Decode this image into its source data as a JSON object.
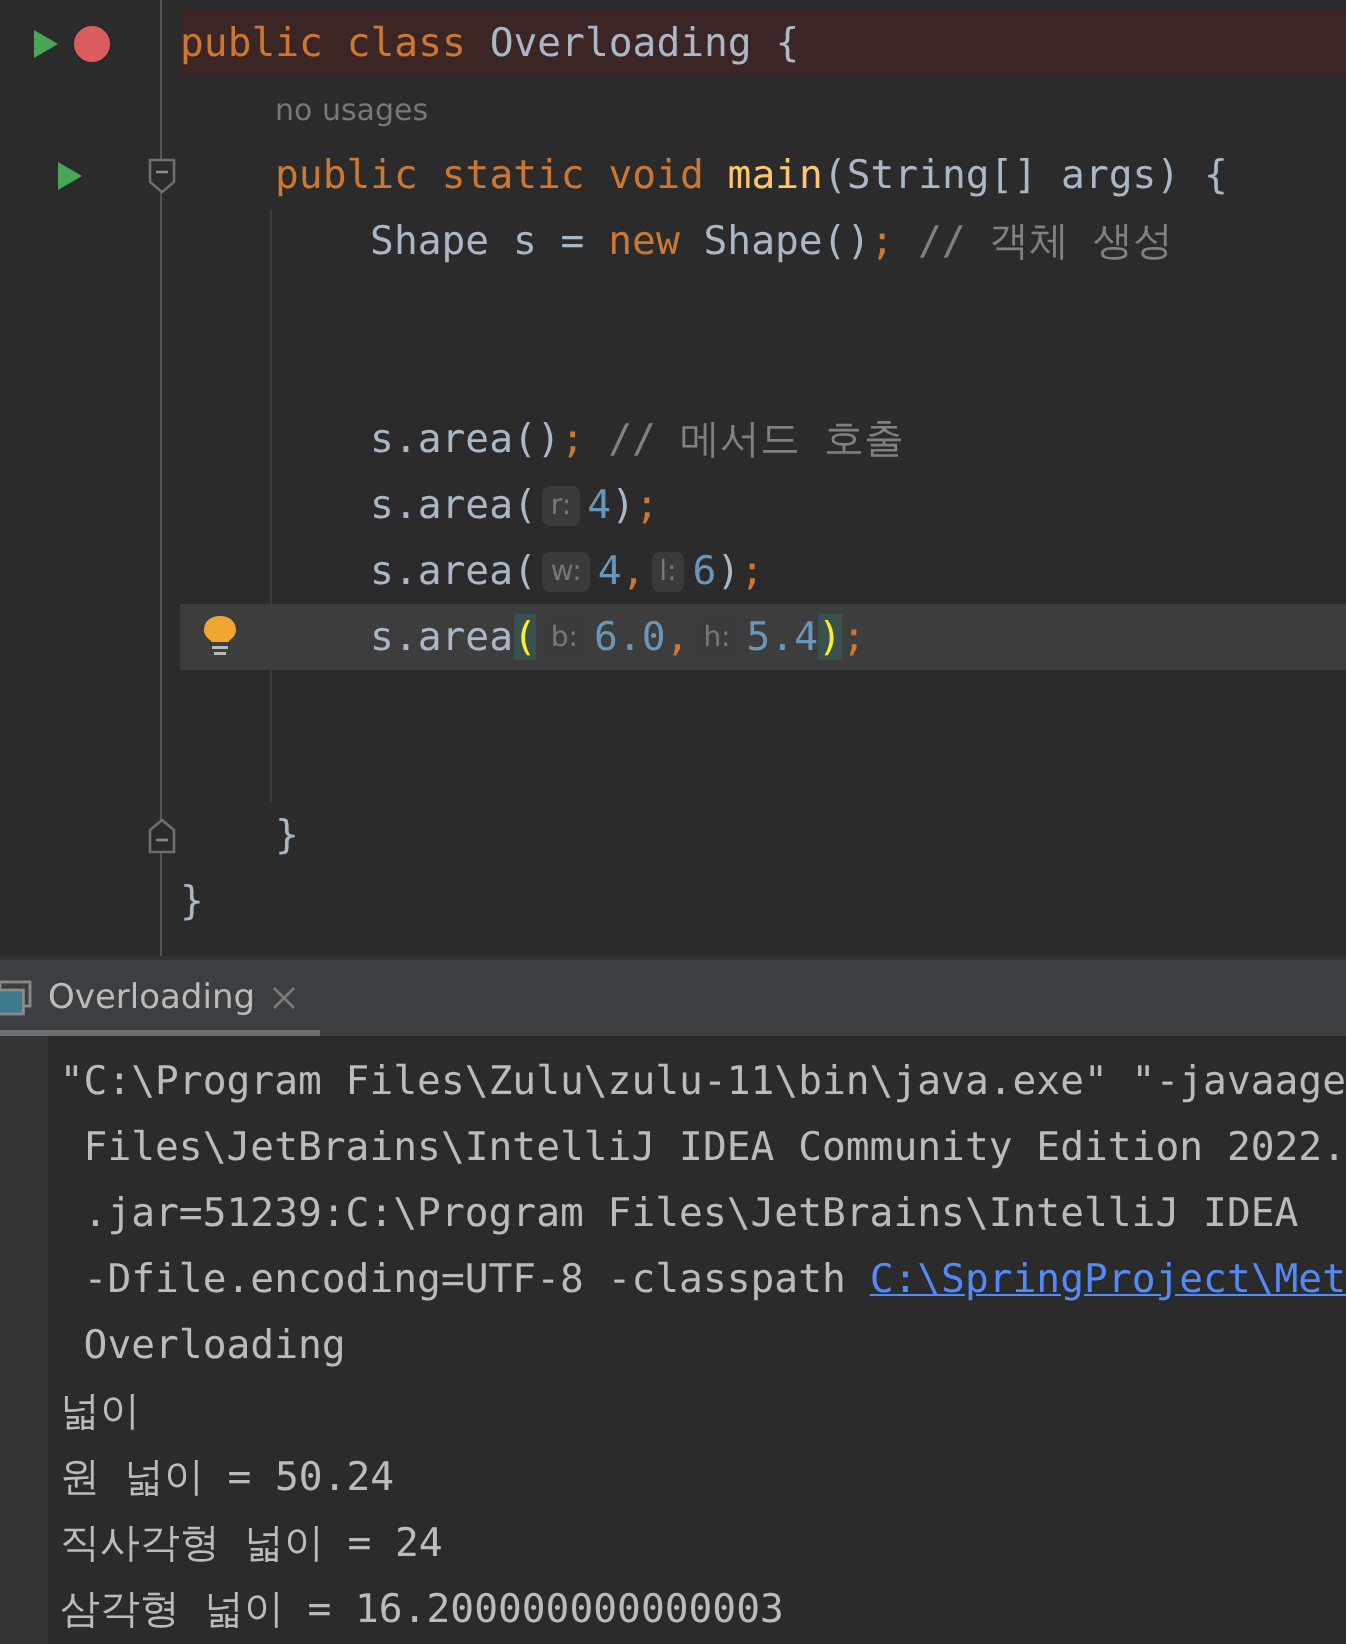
{
  "editor": {
    "lines": [
      {
        "error": true,
        "markers": [
          {
            "kind": "run"
          },
          {
            "kind": "breakpoint"
          }
        ],
        "tokens": [
          {
            "text": "public class ",
            "kind": "keyword"
          },
          {
            "text": "Overloading {",
            "kind": "plain"
          }
        ],
        "children": [
          {
            "error": false,
            "tokens": [
              {
                "text": "no usages",
                "kind": "inlay"
              }
            ]
          },
          {
            "error": false,
            "markers": [
              {
                "kind": "run"
              },
              {
                "kind": "fold"
              }
            ],
            "tokens": [
              {
                "text": "public static void ",
                "kind": "keyword"
              },
              {
                "text": "main",
                "kind": "function"
              },
              {
                "text": "(String[] args) {",
                "kind": "plain"
              }
            ],
            "children": [
              {
                "error": false,
                "tokens": [
                  {
                    "text": "Shape s = ",
                    "kind": "plain"
                  },
                  {
                    "text": "new ",
                    "kind": "keyword"
                  },
                  {
                    "text": "Shape()",
                    "kind": "plain"
                  },
                  {
                    "text": ";",
                    "kind": "keyword"
                  },
                  {
                    "text": " // 객체 생성",
                    "kind": "comment"
                  }
                ]
              },
              {
                "error": false
              },
              {
                "error": false
              },
              {
                "error": false,
                "tokens": [
                  {
                    "text": "s.area()",
                    "kind": "plain"
                  },
                  {
                    "text": ";",
                    "kind": "keyword"
                  },
                  {
                    "text": " // 메서드 호출",
                    "kind": "comment"
                  }
                ]
              },
              {
                "error": false,
                "tokens": [
                  {
                    "text": "s.area(",
                    "kind": "plain"
                  },
                  {
                    "text": "r:",
                    "kind": "hint"
                  },
                  {
                    "text": "4",
                    "kind": "number"
                  },
                  {
                    "text": ")",
                    "kind": "plain"
                  },
                  {
                    "text": ";",
                    "kind": "keyword"
                  }
                ]
              },
              {
                "error": false,
                "tokens": [
                  {
                    "text": "s.area(",
                    "kind": "plain"
                  },
                  {
                    "text": "w:",
                    "kind": "hint"
                  },
                  {
                    "text": "4",
                    "kind": "number"
                  },
                  {
                    "text": ",",
                    "kind": "keyword"
                  },
                  {
                    "text": "l:",
                    "kind": "hint"
                  },
                  {
                    "text": "6",
                    "kind": "number"
                  },
                  {
                    "text": ")",
                    "kind": "plain"
                  },
                  {
                    "text": ";",
                    "kind": "keyword"
                  }
                ]
              },
              {
                "error": false,
                "current": true,
                "markers": [
                  {
                    "kind": "intention"
                  }
                ],
                "tokens": [
                  {
                    "text": "s.area",
                    "kind": "plain"
                  },
                  {
                    "text": "(",
                    "kind": "brace-match"
                  },
                  {
                    "text": "b:",
                    "kind": "hint"
                  },
                  {
                    "text": "6.0",
                    "kind": "number"
                  },
                  {
                    "text": ",",
                    "kind": "keyword"
                  },
                  {
                    "text": "h:",
                    "kind": "hint"
                  },
                  {
                    "text": "5.4",
                    "kind": "number"
                  },
                  {
                    "text": ")",
                    "kind": "brace-match"
                  },
                  {
                    "text": ";",
                    "kind": "keyword"
                  }
                ]
              },
              {
                "error": false
              },
              {
                "error": false
              }
            ]
          },
          {
            "error": false,
            "markers": [
              {
                "kind": "fold-end"
              }
            ],
            "tokens": [
              {
                "text": "}",
                "kind": "plain"
              }
            ]
          }
        ]
      },
      {
        "error": false,
        "tokens": [
          {
            "text": "}",
            "kind": "plain"
          }
        ]
      }
    ]
  },
  "run_panel": {
    "tabs": [
      {
        "label": "Overloading",
        "selected": true
      }
    ],
    "output": [
      {
        "parts": [
          {
            "text": "\"C:\\Program Files\\Zulu\\zulu-11\\bin\\java.exe\" \"-javaage",
            "kind": "text"
          }
        ]
      },
      {
        "parts": [
          {
            "text": " Files\\JetBrains\\IntelliJ IDEA Community Edition 2022.",
            "kind": "text"
          }
        ]
      },
      {
        "parts": [
          {
            "text": " .jar=51239:C:\\Program Files\\JetBrains\\IntelliJ IDEA",
            "kind": "text"
          }
        ]
      },
      {
        "parts": [
          {
            "text": " -Dfile.encoding=UTF-8 -classpath ",
            "kind": "text"
          },
          {
            "text": "C:\\SpringProject\\Met",
            "kind": "link"
          }
        ]
      },
      {
        "parts": [
          {
            "text": " Overloading",
            "kind": "text"
          }
        ]
      },
      {
        "parts": [
          {
            "text": "넓이",
            "kind": "text"
          }
        ]
      },
      {
        "parts": [
          {
            "text": "원 넓이 = 50.24",
            "kind": "text"
          }
        ]
      },
      {
        "parts": [
          {
            "text": "직사각형 넓이 = 24",
            "kind": "text"
          }
        ]
      },
      {
        "parts": [
          {
            "text": "삼각형 넓이 = 16.200000000000003",
            "kind": "text"
          }
        ]
      }
    ]
  }
}
